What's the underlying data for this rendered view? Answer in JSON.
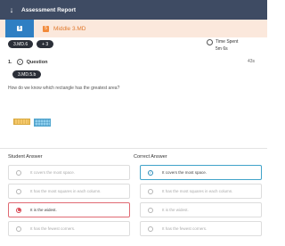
{
  "window": {
    "title": "Assessment Report"
  },
  "lesson_bar": {
    "tab_label": "5",
    "grade_badge": "5",
    "lesson_name": "Middle 3.MD"
  },
  "standards": {
    "primary": "3.MD.6",
    "more": "+ 3"
  },
  "time_spent": {
    "label": "Time Spent",
    "value": "5m 6s"
  },
  "question": {
    "number": "1.",
    "title": "Question",
    "time": "43s",
    "standard": "3.MD.5.b",
    "prompt": "How do we know which rectangle has the greatest area?"
  },
  "student_answer": {
    "header": "Student Answer",
    "options": [
      {
        "text": "It covers the most space.",
        "state": "none"
      },
      {
        "text": "It has the most squares in each column.",
        "state": "none"
      },
      {
        "text": "It is the widest.",
        "state": "selected-wrong"
      },
      {
        "text": "It has the fewest corners.",
        "state": "none"
      }
    ]
  },
  "correct_answer": {
    "header": "Correct Answer",
    "options": [
      {
        "text": "It covers the most space.",
        "state": "correct"
      },
      {
        "text": "It has the most squares in each column.",
        "state": "none"
      },
      {
        "text": "It is the widest.",
        "state": "none"
      },
      {
        "text": "It has the fewest corners.",
        "state": "none"
      }
    ]
  },
  "colors": {
    "header": "#3e4b63",
    "tab": "#2f7fc3",
    "lesson_bar": "#fbe8dc",
    "wrong": "#d9434f",
    "correct": "#2b8bb8"
  },
  "icons": {
    "back": "arrow-down-icon",
    "clock": "clock-icon",
    "question": "question-circle-icon"
  }
}
